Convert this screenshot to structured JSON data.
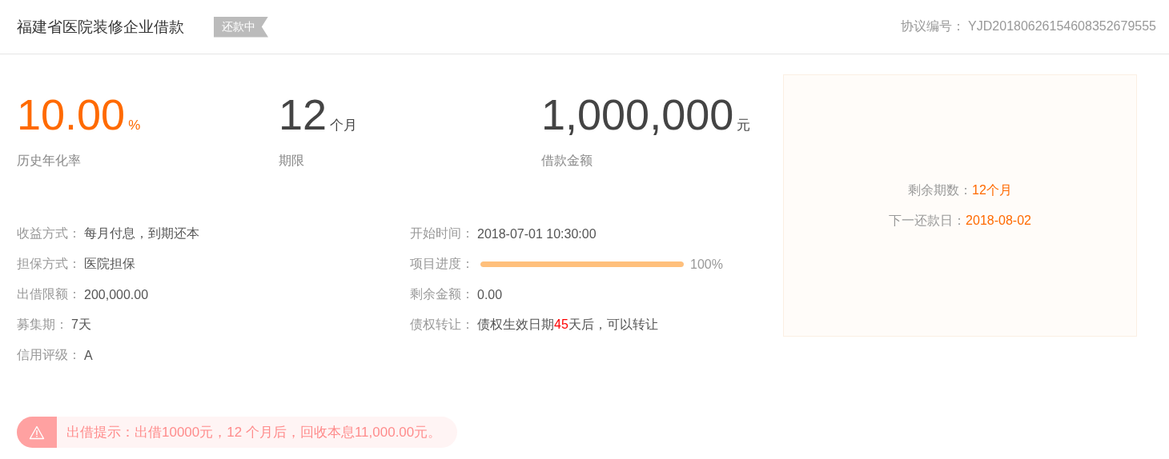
{
  "header": {
    "title": "福建省医院装修企业借款",
    "status_tag": "还款中",
    "agreement_label": "协议编号：",
    "agreement_number": "YJD20180626154608352679555"
  },
  "stats": [
    {
      "value": "10.00",
      "unit": "%",
      "label": "历史年化率",
      "kind": "rate"
    },
    {
      "value": "12",
      "unit": "个月",
      "label": "期限",
      "kind": "plain"
    },
    {
      "value": "1,000,000",
      "unit": "元",
      "label": "借款金额",
      "kind": "plain"
    }
  ],
  "details_left": [
    {
      "label": "收益方式：",
      "value": "每月付息，到期还本"
    },
    {
      "label": "担保方式：",
      "value": "医院担保"
    },
    {
      "label": "出借限额：",
      "value": "200,000.00"
    },
    {
      "label": "募集期：",
      "value": "7天"
    },
    {
      "label": "信用评级：",
      "value": "A"
    }
  ],
  "details_right": [
    {
      "kind": "text",
      "label": "开始时间：",
      "value": "2018-07-01 10:30:00"
    },
    {
      "kind": "progress",
      "label": "项目进度：",
      "level": 1.0,
      "reading": "100%"
    },
    {
      "kind": "text",
      "label": "剩余金额：",
      "value": "0.00"
    },
    {
      "kind": "segments",
      "label": "债权转让：",
      "segments": [
        {
          "text": "债权生效日期",
          "highlight": false
        },
        {
          "text": "45",
          "highlight": true
        },
        {
          "text": "天后，可以转让",
          "highlight": false
        }
      ]
    }
  ],
  "side_panel": [
    {
      "label": "剩余期数：",
      "value": "12个月"
    },
    {
      "label": "下一还款日：",
      "value": "2018-08-02"
    }
  ],
  "tip": {
    "text": "出借提示：出借10000元，12 个月后，回收本息11,000.00元。"
  }
}
